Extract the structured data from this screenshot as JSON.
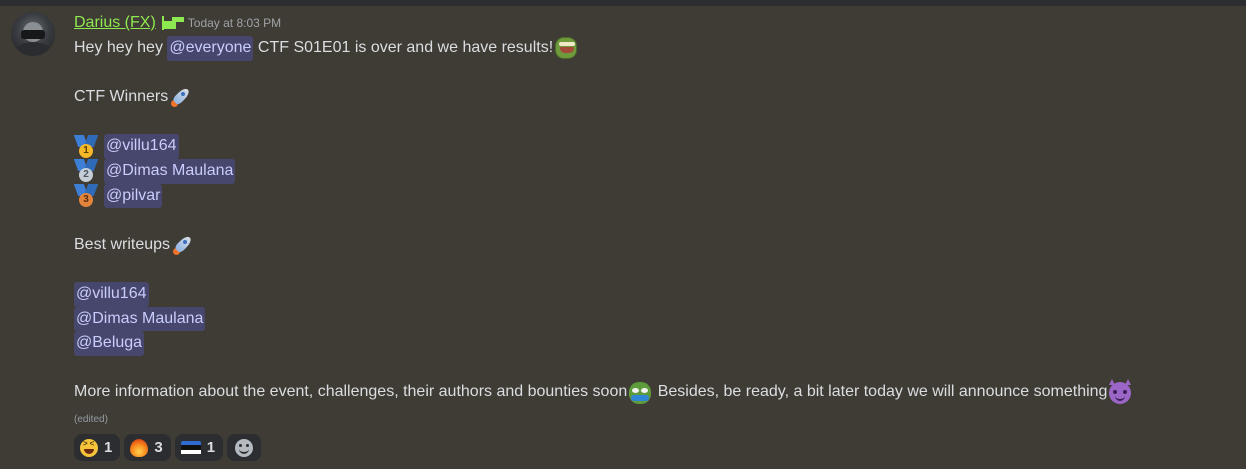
{
  "message": {
    "author": "Darius (FX)",
    "timestamp": "Today at 8:03 PM",
    "role_icon": "green-flag-icon",
    "line1": {
      "text_before": "Hey hey hey ",
      "mention": "@everyone",
      "text_after": " CTF S01E01 is over and we have results!",
      "emoji": "pepe-laugh"
    },
    "winners_heading": "CTF Winners",
    "winners": [
      {
        "place": "1",
        "mention": "@villu164",
        "medal": "gold-medal-icon"
      },
      {
        "place": "2",
        "mention": "@Dimas Maulana",
        "medal": "silver-medal-icon"
      },
      {
        "place": "3",
        "mention": "@pilvar",
        "medal": "bronze-medal-icon"
      }
    ],
    "writeups_heading": "Best writeups",
    "writeups": [
      "@villu164",
      "@Dimas Maulana",
      "@Beluga"
    ],
    "final_line": {
      "text_before": "More information about the event, challenges, their authors and bounties soon",
      "text_after": " Besides, be ready, a bit later today we will announce something"
    },
    "edited_label": "(edited)"
  },
  "reactions": [
    {
      "emoji": "grinning-squinting-face",
      "count": "1"
    },
    {
      "emoji": "fire",
      "count": "3"
    },
    {
      "emoji": "flag-estonia",
      "count": "1"
    }
  ],
  "colors": {
    "background": "#3f3b35",
    "username": "#8ee84f",
    "mention_bg": "rgba(88,101,242,0.3)",
    "mention_text": "#c9cdfb",
    "reaction_bg": "#2b2d31",
    "estonia_flag": [
      "#2f6bd1",
      "#111111",
      "#ffffff"
    ]
  }
}
